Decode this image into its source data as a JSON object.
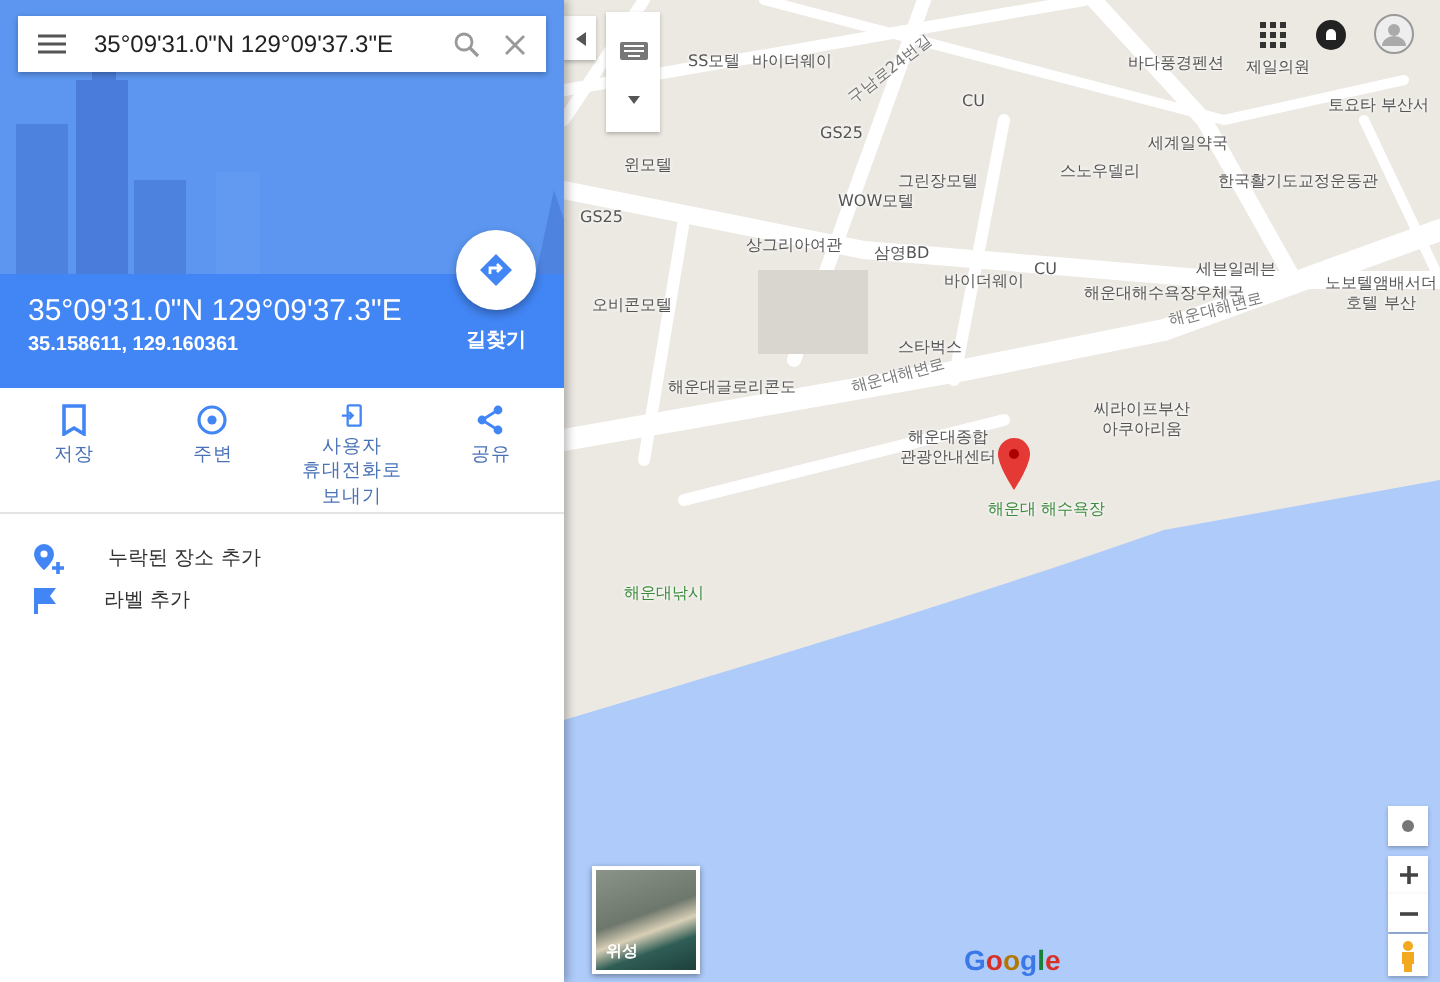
{
  "search": {
    "value": "35°09'31.0\"N 129°09'37.3\"E"
  },
  "place": {
    "title": "35°09'31.0\"N 129°09'37.3\"E",
    "decimal": "35.158611, 129.160361",
    "directions_label": "길찾기"
  },
  "actions": [
    {
      "kind": "save",
      "label": "저장"
    },
    {
      "kind": "nearby",
      "label": "주변"
    },
    {
      "kind": "phone",
      "label": "사용자 휴대전화로 보내기"
    },
    {
      "kind": "share",
      "label": "공유"
    }
  ],
  "links": [
    {
      "kind": "add-place",
      "label": "누락된 장소 추가"
    },
    {
      "kind": "label",
      "label": "라벨 추가"
    }
  ],
  "map_labels": [
    {
      "kind": "poi",
      "text": "SS모텔"
    },
    {
      "kind": "poi",
      "text": "바이더웨이"
    },
    {
      "kind": "road",
      "text": "구남로24번길"
    },
    {
      "kind": "poi",
      "text": "CU"
    },
    {
      "kind": "poi",
      "text": "GS25"
    },
    {
      "kind": "poi",
      "text": "윈모텔"
    },
    {
      "kind": "poi",
      "text": "GS25"
    },
    {
      "kind": "poi",
      "text": "그린장모텔"
    },
    {
      "kind": "poi",
      "text": "WOW모텔"
    },
    {
      "kind": "poi",
      "text": "바다풍경펜션"
    },
    {
      "kind": "poi",
      "text": "제일의원"
    },
    {
      "kind": "poi",
      "text": "토요타 부산서"
    },
    {
      "kind": "poi",
      "text": "세계일약국"
    },
    {
      "kind": "poi",
      "text": "스노우델리"
    },
    {
      "kind": "poi",
      "text": "한국활기도교정운동관"
    },
    {
      "kind": "poi",
      "text": "상그리아여관"
    },
    {
      "kind": "poi",
      "text": "삼영BD"
    },
    {
      "kind": "poi",
      "text": "바이더웨이"
    },
    {
      "kind": "poi",
      "text": "CU"
    },
    {
      "kind": "poi",
      "text": "세븐일레븐"
    },
    {
      "kind": "poi",
      "text": "해운대해수욕장우체국"
    },
    {
      "kind": "poi",
      "text": "오비콘모텔"
    },
    {
      "kind": "poi",
      "text": "노보텔앰배서더 호텔 부산"
    },
    {
      "kind": "poi",
      "text": "스타벅스"
    },
    {
      "kind": "road",
      "text": "해운대해변로"
    },
    {
      "kind": "road",
      "text": "해운대해변로"
    },
    {
      "kind": "poi",
      "text": "해운대글로리콘도"
    },
    {
      "kind": "poi",
      "text": "씨라이프부산 아쿠아리움"
    },
    {
      "kind": "poi",
      "text": "해운대종합 관광안내센터"
    },
    {
      "kind": "park",
      "text": "해운대 해수욕장"
    },
    {
      "kind": "park",
      "text": "해운대낚시"
    }
  ],
  "satellite_label": "위성",
  "logo": "Google"
}
